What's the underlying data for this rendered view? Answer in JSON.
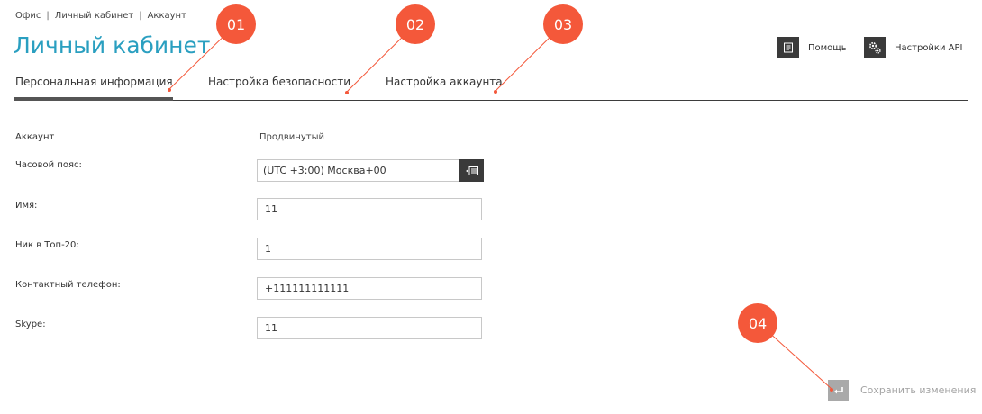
{
  "breadcrumb": {
    "items": [
      "Офис",
      "Личный кабинет",
      "Аккаунт"
    ],
    "separator": "|"
  },
  "page_title": "Личный кабинет",
  "header": {
    "help_label": "Помощь",
    "help_icon": "document-icon",
    "api_label": "Настройки API",
    "api_icon": "gears-icon"
  },
  "tabs": [
    {
      "label": "Персональная информация",
      "active": true
    },
    {
      "label": "Настройка безопасности",
      "active": false
    },
    {
      "label": "Настройка аккаунта",
      "active": false
    }
  ],
  "form": {
    "account": {
      "label": "Аккаунт",
      "value": "Продвинутый"
    },
    "timezone": {
      "label": "Часовой пояс:",
      "value": "(UTC +3:00) Москва+00"
    },
    "name": {
      "label": "Имя:",
      "value": "11"
    },
    "nick": {
      "label": "Ник в Топ-20:",
      "value": "1"
    },
    "phone": {
      "label": "Контактный телефон:",
      "value": "+111111111111"
    },
    "skype": {
      "label": "Skype:",
      "value": "11"
    }
  },
  "save_label": "Сохранить изменения",
  "annotations": [
    "01",
    "02",
    "03",
    "04"
  ],
  "colors": {
    "accent": "#2a9fc0",
    "marker": "#f4583a",
    "dark": "#3a3a3a",
    "disabled": "#a9a9a9"
  }
}
